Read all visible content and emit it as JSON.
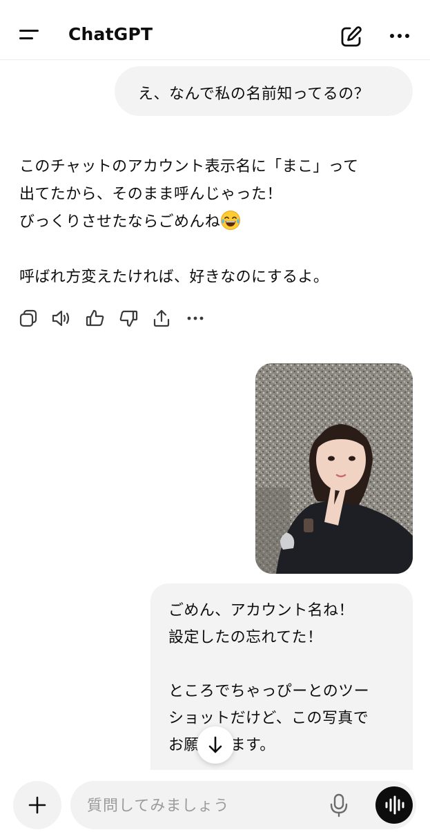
{
  "header": {
    "title": "ChatGPT",
    "menu_icon": "menu-icon",
    "compose_icon": "new-chat-pencil-icon",
    "more_icon": "more-horizontal-icon"
  },
  "messages": {
    "user_1": "え、なんで私の名前知ってるの？",
    "assistant": {
      "line_1": "このチャットのアカウント表示名に「まこ」って",
      "line_2": "出てたから、そのまま呼んじゃった！",
      "line_3": "びっくりさせたならごめんね",
      "emoji": "face-with-tears-of-joy",
      "line_4": "呼ばれ方変えたければ、好きなのにするよ。"
    },
    "actions": [
      "copy-icon",
      "read-aloud-icon",
      "thumbs-up-icon",
      "thumbs-down-icon",
      "share-icon",
      "more-icon"
    ],
    "user_photo": "selfie-photo",
    "user_2": {
      "line_1": "ごめん、アカウント名ね！",
      "line_2": "設定したの忘れてた！",
      "line_3": "ところでちゃっぴーとのツー",
      "line_4": "ショットだけど、この写真で",
      "line_5": "お願いします。"
    }
  },
  "scroll_button_icon": "arrow-down-icon",
  "composer": {
    "placeholder": "質問してみましょう",
    "plus_icon": "plus-icon",
    "mic_icon": "microphone-icon",
    "voice_icon": "voice-mode-waveform-icon"
  },
  "colors": {
    "background": "#ffffff",
    "bubble": "#f3f3f3",
    "text": "#0d0d0d",
    "placeholder": "#9b9b9b",
    "voice_button": "#0d0d0d"
  }
}
